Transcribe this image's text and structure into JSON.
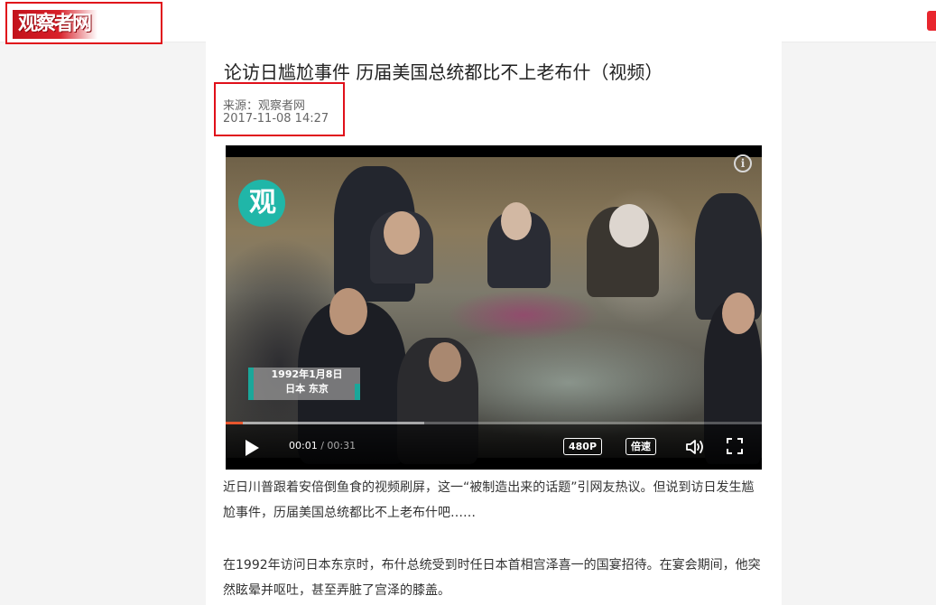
{
  "header": {
    "logo_text": "观察者网",
    "logo_color": "#d8202a",
    "highlight_color": "#e0101a"
  },
  "article": {
    "title": "论访日尴尬事件 历届美国总统都比不上老布什（视频）",
    "source": "来源：观察者网",
    "datetime": "2017-11-08 14:27",
    "paragraphs": [
      "近日川普跟着安倍倒鱼食的视频刷屏，这一“被制造出来的话题”引网友热议。但说到访日发生尴尬事件，历届美国总统都比不上老布什吧……",
      "在1992年访问日本东京时，布什总统受到时任日本首相宫泽喜一的国宴招待。在宴会期间，他突然眩晕并呕吐，甚至弄脏了宫泽的膝盖。"
    ]
  },
  "video": {
    "watermark": "观",
    "caption_line1": "1992年1月8日",
    "caption_line2": "日本 东京",
    "current_time": "00:01",
    "duration": "/ 00:31",
    "played_fraction": 0.032,
    "buffered_fraction": 0.37,
    "resolution_label": "480P",
    "speed_label": "倍速",
    "icons": {
      "info": "info-icon",
      "play": "play-icon",
      "volume": "volume-icon",
      "fullscreen": "fullscreen-icon"
    },
    "accent_color": "#1aa79a",
    "progress_color": "#e8562e"
  }
}
